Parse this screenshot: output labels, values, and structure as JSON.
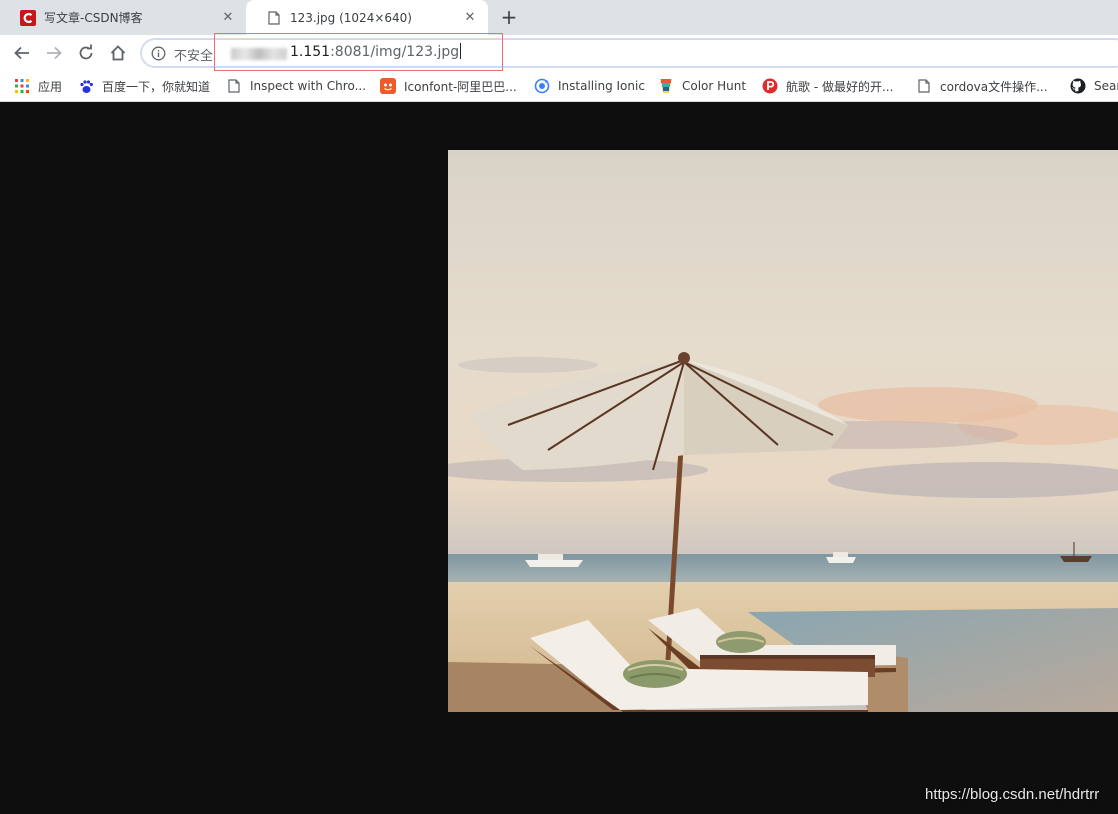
{
  "tabs": [
    {
      "title": "写文章-CSDN博客",
      "favicon": "csdn-logo-icon",
      "active": false
    },
    {
      "title": "123.jpg (1024×640)",
      "favicon": "page-icon",
      "active": true
    }
  ],
  "toolbar": {
    "security_label": "不安全",
    "url_host_visible": "1.151",
    "url_rest": ":8081/img/123.jpg"
  },
  "bookmarks": [
    {
      "label": "应用",
      "icon": "apps-grid-icon"
    },
    {
      "label": "百度一下，你就知道",
      "icon": "baidu-paw-icon"
    },
    {
      "label": "Inspect with Chro...",
      "icon": "page-icon"
    },
    {
      "label": "Iconfont-阿里巴巴...",
      "icon": "iconfont-icon"
    },
    {
      "label": "Installing Ionic",
      "icon": "ionic-icon"
    },
    {
      "label": "Color Hunt",
      "icon": "color-hunt-icon"
    },
    {
      "label": "航歌 - 做最好的开...",
      "icon": "hangge-icon"
    },
    {
      "label": "cordova文件操作...",
      "icon": "page-icon"
    },
    {
      "label": "Sear",
      "icon": "github-icon"
    }
  ],
  "image": {
    "subject": "beach-umbrella-loungers-sunset-photo",
    "watermark": "https://blog.csdn.net/hdrtrr"
  },
  "colors": {
    "tabstrip": "#dee1e6",
    "viewer_bg": "#0e0e0e",
    "highlight": "#e8707c"
  }
}
